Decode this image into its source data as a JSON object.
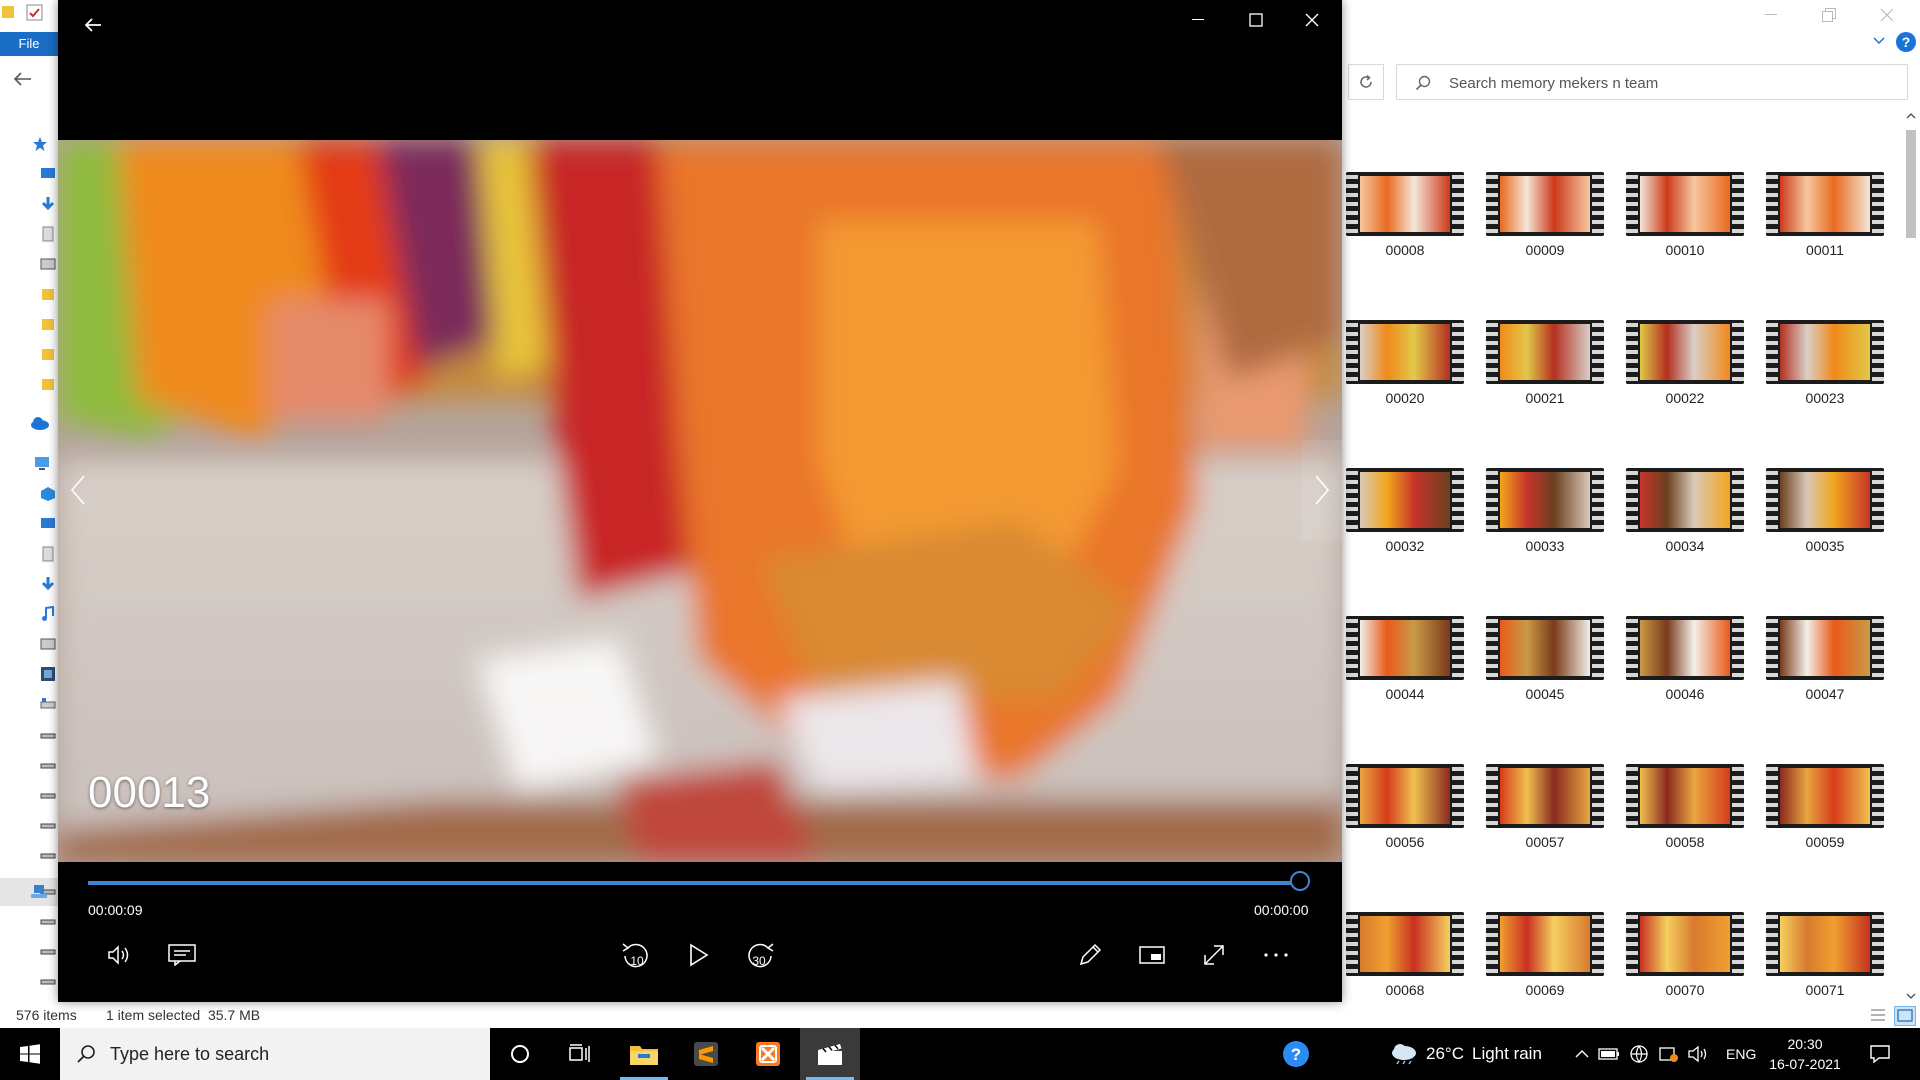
{
  "explorer": {
    "file_tab": "File",
    "search_placeholder": "Search memory mekers n team",
    "status_items": "576 items",
    "status_selected": "1 item selected  35.7 MB",
    "thumbnails": [
      "00008",
      "00009",
      "00010",
      "00011",
      "00020",
      "00021",
      "00022",
      "00023",
      "00032",
      "00033",
      "00034",
      "00035",
      "00044",
      "00045",
      "00046",
      "00047",
      "00056",
      "00057",
      "00058",
      "00059",
      "00068",
      "00069",
      "00070",
      "00071"
    ]
  },
  "player": {
    "video_title": "00013",
    "time_elapsed": "00:00:09",
    "time_remaining": "00:00:00",
    "progress": 0.995,
    "skip_back_label": "10",
    "skip_forward_label": "30",
    "accent_color": "#3c86d4"
  },
  "taskbar": {
    "search_placeholder": "Type here to search",
    "weather_temp": "26°C",
    "weather_desc": "Light rain",
    "language": "ENG",
    "time": "20:30",
    "date": "16-07-2021"
  }
}
